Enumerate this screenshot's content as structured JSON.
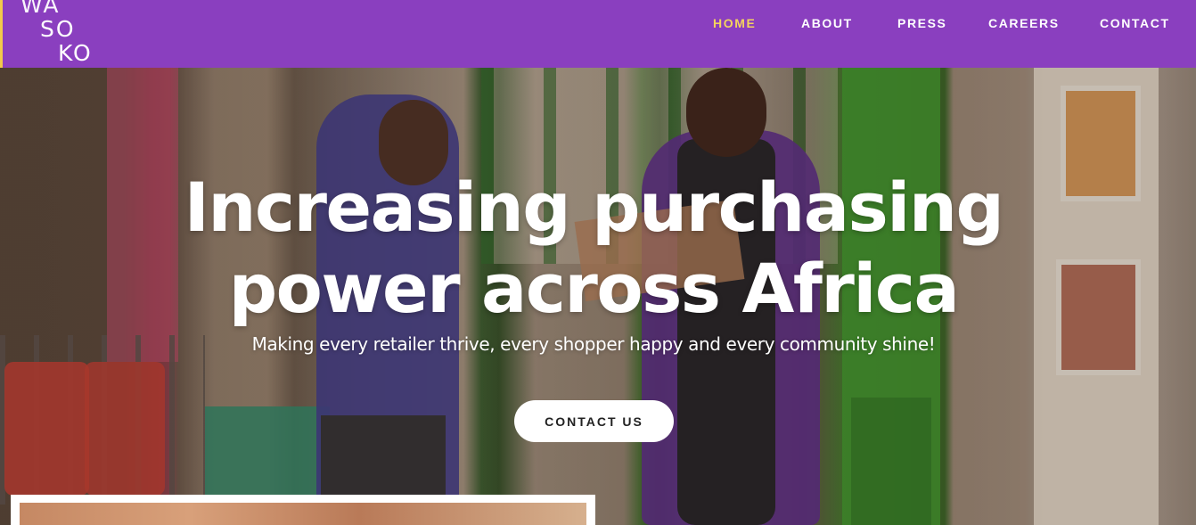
{
  "brand": {
    "logo_rows": [
      "WA",
      "SO",
      "KO"
    ]
  },
  "nav": {
    "items": [
      {
        "label": "HOME",
        "active": true
      },
      {
        "label": "ABOUT",
        "active": false
      },
      {
        "label": "PRESS",
        "active": false
      },
      {
        "label": "CAREERS",
        "active": false
      },
      {
        "label": "CONTACT",
        "active": false
      }
    ]
  },
  "hero": {
    "title_line1": "Increasing purchasing",
    "title_line2": "power across Africa",
    "subtitle": "Making every retailer thrive, every shopper happy and every community shine!",
    "cta_label": "CONTACT US"
  },
  "colors": {
    "header_bg": "#8a3fbf",
    "nav_active": "#f4d35e",
    "nav_text": "#ffffff",
    "accent_border": "#f2c94c"
  }
}
